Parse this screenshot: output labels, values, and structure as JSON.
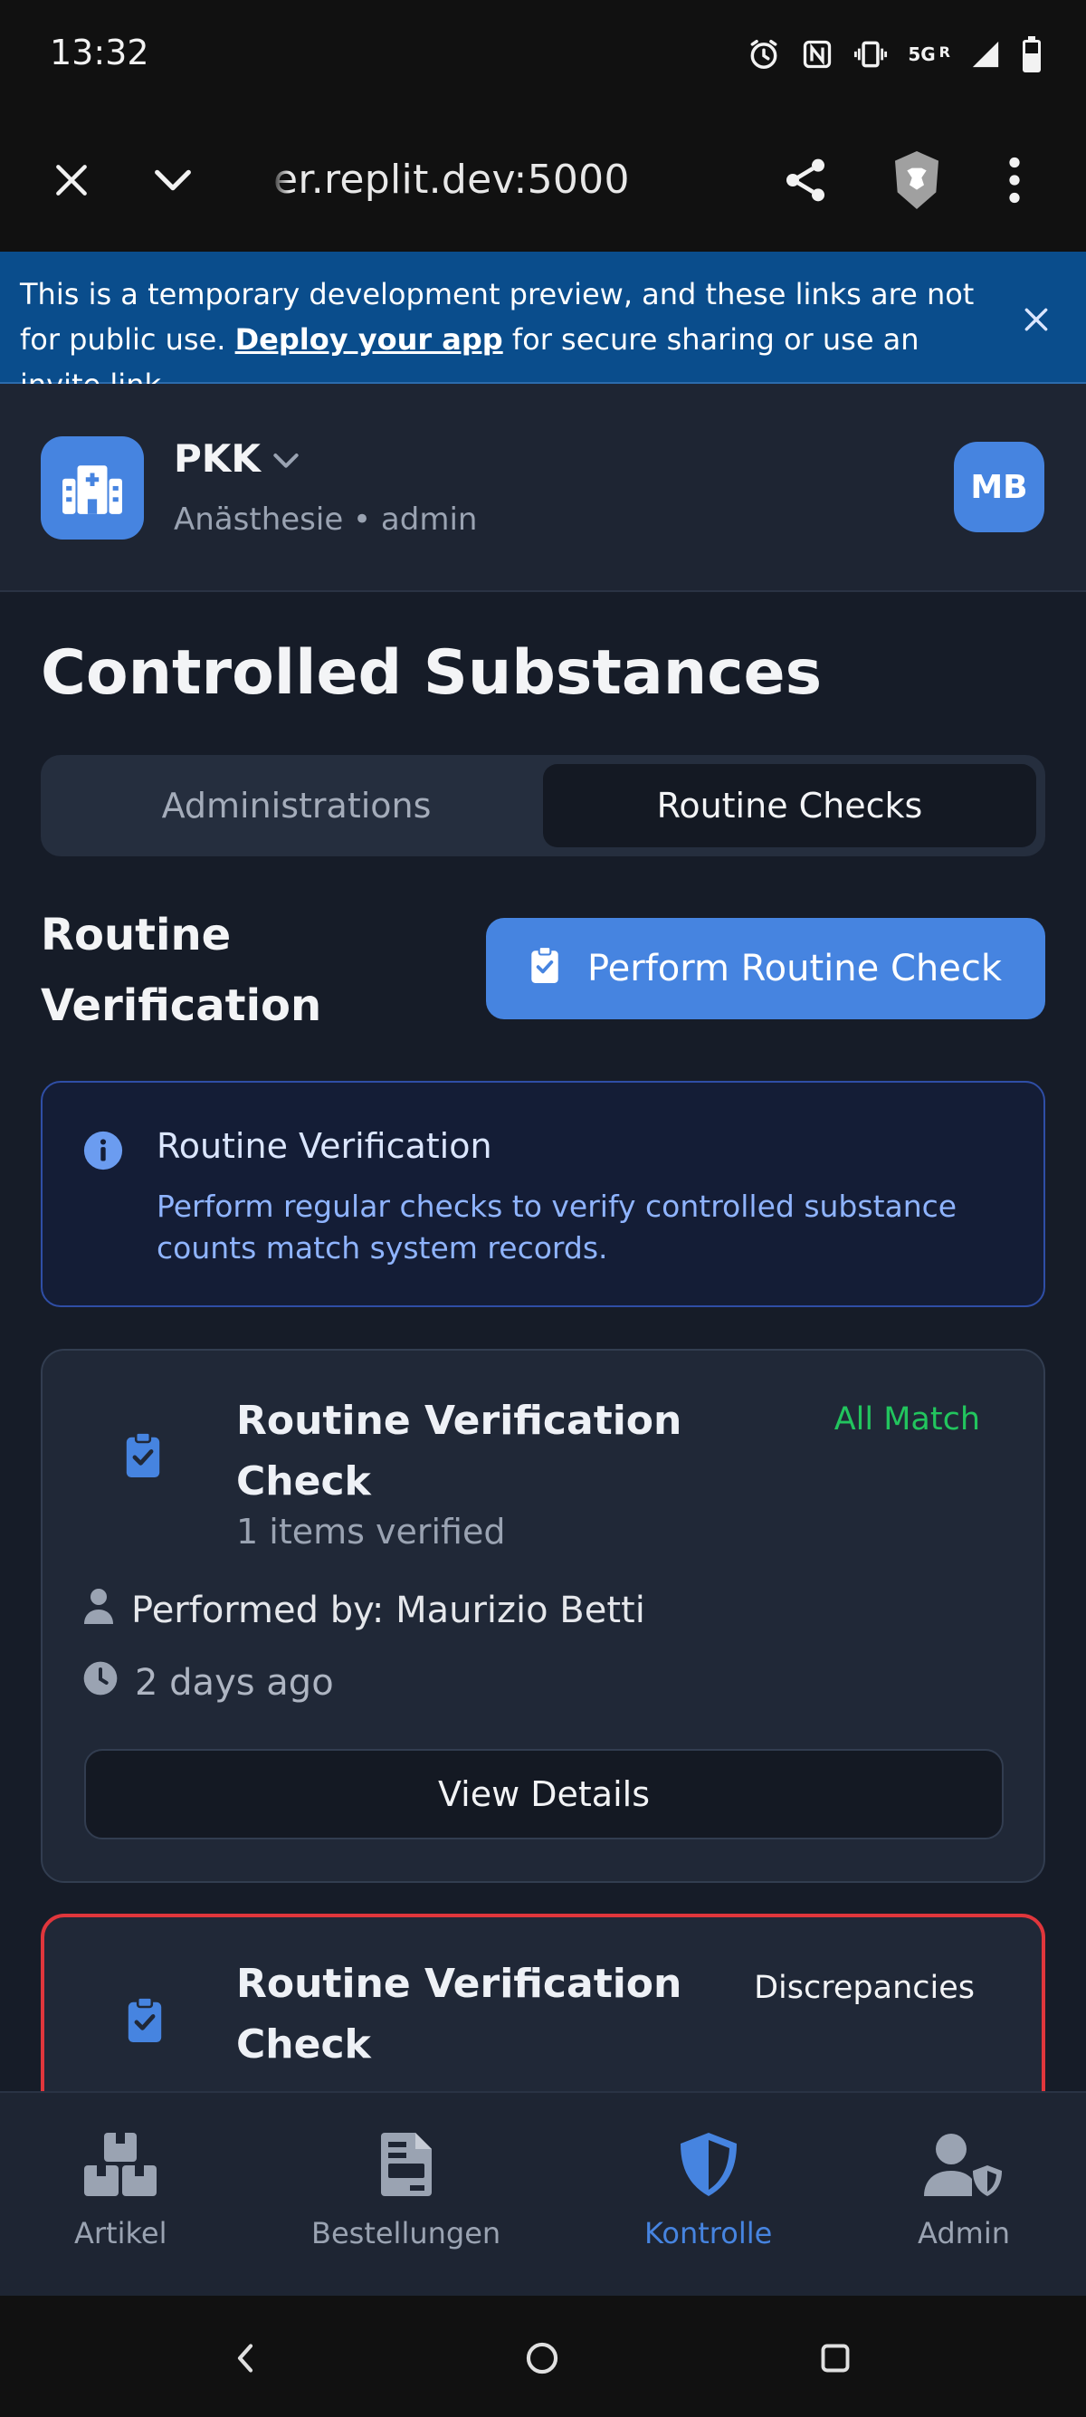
{
  "status_bar": {
    "time": "13:32",
    "network": "5G",
    "roaming": "R"
  },
  "browser": {
    "url": "er.replit.dev:5000"
  },
  "banner": {
    "text_before": "This is a temporary development preview, and these links are not for public use. ",
    "link": "Deploy your app",
    "text_after": " for secure sharing or use an invite link."
  },
  "header": {
    "org_name": "PKK",
    "subtitle": "Anästhesie • admin",
    "avatar_initials": "MB"
  },
  "page": {
    "title": "Controlled Substances",
    "tabs": [
      {
        "label": "Administrations",
        "active": false
      },
      {
        "label": "Routine Checks",
        "active": true
      }
    ],
    "section_title": "Routine Verification",
    "perform_button": "Perform Routine Check"
  },
  "info": {
    "title": "Routine Verification",
    "text": "Perform regular checks to verify controlled substance counts match system records."
  },
  "checks": [
    {
      "title": "Routine Verification Check",
      "status": "All Match",
      "items_verified": "1 items verified",
      "performed_by": "Performed by: Maurizio Betti",
      "time_ago": "2 days ago",
      "view_button": "View Details"
    },
    {
      "title": "Routine Verification Check",
      "status": "Discrepancies"
    }
  ],
  "bottom_nav": [
    {
      "label": "Artikel",
      "icon": "boxes-icon",
      "active": false
    },
    {
      "label": "Bestellungen",
      "icon": "file-invoice-icon",
      "active": false
    },
    {
      "label": "Kontrolle",
      "icon": "shield-icon",
      "active": true
    },
    {
      "label": "Admin",
      "icon": "user-shield-icon",
      "active": false
    }
  ],
  "colors": {
    "accent": "#4684e0",
    "success": "#22c55e",
    "danger": "#e0363c",
    "banner": "#0a4d8c"
  }
}
